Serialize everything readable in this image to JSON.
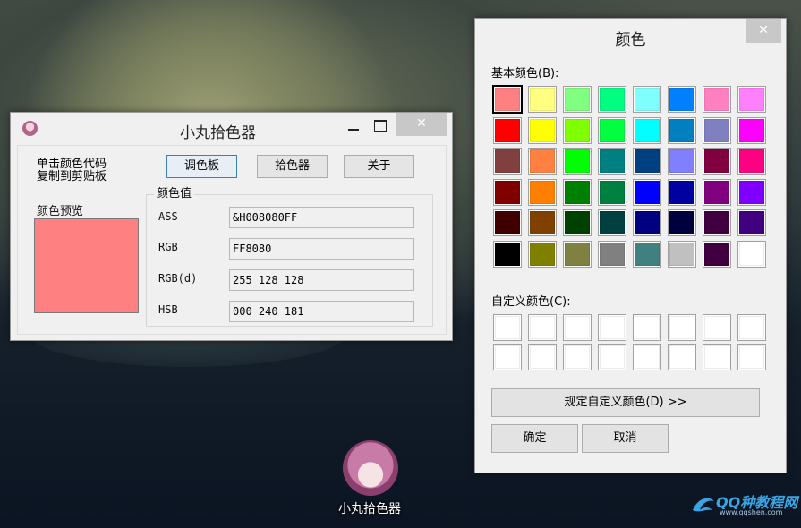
{
  "picker": {
    "title": "小丸拾色器",
    "close": "✕",
    "hint": [
      "单击颜色代码",
      "复制到剪贴板"
    ],
    "buttons": [
      "调色板",
      "拾色器",
      "关于"
    ],
    "preview_label": "颜色预览",
    "preview_color": "#ff8080",
    "group_title": "颜色值",
    "fields": [
      {
        "label": "ASS",
        "value": "&H008080FF"
      },
      {
        "label": "RGB",
        "value": "FF8080"
      },
      {
        "label": "RGB(d)",
        "value": "255 128 128"
      },
      {
        "label": "HSB",
        "value": "000 240 181"
      }
    ]
  },
  "dialog": {
    "title": "颜色",
    "close": "✕",
    "basic_label": "基本颜色(B):",
    "basic_colors": [
      [
        "#ff8080",
        "#ffff80",
        "#80ff80",
        "#00ff80",
        "#80ffff",
        "#0080ff",
        "#ff80c0",
        "#ff80ff"
      ],
      [
        "#ff0000",
        "#ffff00",
        "#80ff00",
        "#00ff40",
        "#00ffff",
        "#0080c0",
        "#8080c0",
        "#ff00ff"
      ],
      [
        "#804040",
        "#ff8040",
        "#00ff00",
        "#008080",
        "#004080",
        "#8080ff",
        "#800040",
        "#ff0080"
      ],
      [
        "#800000",
        "#ff8000",
        "#008000",
        "#008040",
        "#0000ff",
        "#0000a0",
        "#800080",
        "#8000ff"
      ],
      [
        "#400000",
        "#804000",
        "#004000",
        "#004040",
        "#000080",
        "#000040",
        "#400040",
        "#400080"
      ],
      [
        "#000000",
        "#808000",
        "#808040",
        "#808080",
        "#408080",
        "#c0c0c0",
        "#400040",
        "#ffffff"
      ]
    ],
    "custom_label": "自定义颜色(C):",
    "custom_colors": [
      [
        "#ffffff",
        "#ffffff",
        "#ffffff",
        "#ffffff",
        "#ffffff",
        "#ffffff",
        "#ffffff",
        "#ffffff"
      ],
      [
        "#ffffff",
        "#ffffff",
        "#ffffff",
        "#ffffff",
        "#ffffff",
        "#ffffff",
        "#ffffff",
        "#ffffff"
      ]
    ],
    "define_custom": "规定自定义颜色(D) >>",
    "ok": "确定",
    "cancel": "取消"
  },
  "desktop": {
    "icon_label": "小丸拾色器"
  },
  "watermark": {
    "name": "QQ种教程网",
    "url": "www.qqshen.com"
  }
}
